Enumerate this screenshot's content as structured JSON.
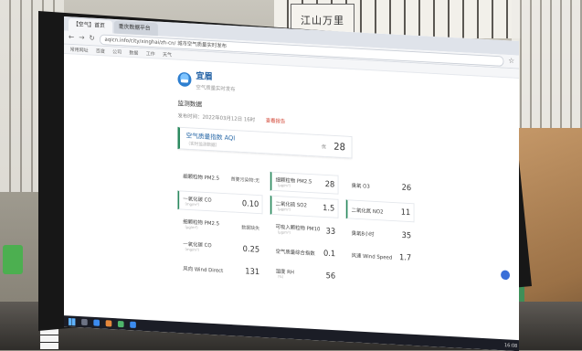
{
  "room": {
    "calligraphy": "江山万里"
  },
  "monitor": {
    "brand": "acer"
  },
  "browser": {
    "tabs": [
      "【空气】首页",
      "重庆数据平台"
    ],
    "url": "aqicn.info/city/xinghai/zh-cn/  城市空气质量实时发布",
    "bookmarks": [
      "常用网址",
      "百度",
      "公司",
      "数据",
      "工作",
      "天气"
    ]
  },
  "page": {
    "brand": {
      "name": "宜眉",
      "subtitle": "空气质量实时发布"
    },
    "section_title": "监测数据",
    "meta": {
      "time": "发布时间：2022年03月12日 16时",
      "link": "查看报告"
    },
    "aqi": {
      "label": "空气质量指数 AQI",
      "sub": "（实时监测数据）",
      "tag": "优",
      "value": "28"
    },
    "cells": [
      {
        "name": "细颗粒物 PM2.5",
        "sub": "",
        "value": "首要污染物:无",
        "small": true,
        "boxed": false
      },
      {
        "name": "细颗粒物 PM2.5",
        "sub": "（μg/m³）",
        "value": "28",
        "small": false,
        "boxed": true
      },
      {
        "name": "臭氧 O3",
        "sub": "",
        "value": "26",
        "small": false,
        "boxed": false
      },
      {
        "name": "一氧化碳 CO",
        "sub": "（mg/m³）",
        "value": "0.10",
        "small": false,
        "boxed": true
      },
      {
        "name": "二氧化硫 SO2",
        "sub": "（μg/m³）",
        "value": "1.5",
        "small": false,
        "boxed": true
      },
      {
        "name": "二氧化氮 NO2",
        "sub": "",
        "value": "11",
        "small": false,
        "boxed": true
      },
      {
        "name": "细颗粒物 PM2.5",
        "sub": "（μg/m³）",
        "value": "数据缺失",
        "small": true,
        "boxed": false
      },
      {
        "name": "可吸入颗粒物 PM10",
        "sub": "（μg/m³）",
        "value": "33",
        "small": false,
        "boxed": false
      },
      {
        "name": "臭氧8小时",
        "sub": "",
        "value": "35",
        "small": false,
        "boxed": false
      },
      {
        "name": "一氧化碳 CO",
        "sub": "（mg/m³）",
        "value": "0.25",
        "small": false,
        "boxed": false
      },
      {
        "name": "空气质量综合指数",
        "sub": "",
        "value": "0.1",
        "small": false,
        "boxed": false
      },
      {
        "name": "风速 Wind Speed",
        "sub": "",
        "value": "1.7",
        "small": false,
        "boxed": false
      },
      {
        "name": "风向 Wind Direct",
        "sub": "",
        "value": "131",
        "small": false,
        "boxed": false
      },
      {
        "name": "湿度 RH",
        "sub": "（%）",
        "value": "56",
        "small": false,
        "boxed": false
      }
    ]
  }
}
